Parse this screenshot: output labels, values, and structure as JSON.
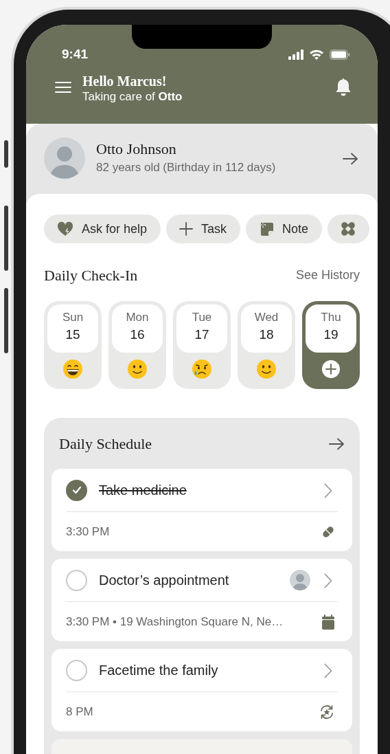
{
  "status_bar": {
    "time": "9:41"
  },
  "header": {
    "greeting": "Hello Marcus!",
    "subtitle": "Taking care of **Otto**"
  },
  "profile": {
    "name": "Otto Johnson",
    "details": "82 years old (Birthday in 112 days)"
  },
  "quick_actions": [
    {
      "kind": "help",
      "label": "Ask for help"
    },
    {
      "kind": "task",
      "label": "Task"
    },
    {
      "kind": "note",
      "label": "Note"
    },
    {
      "kind": "bandage"
    }
  ],
  "check_in": {
    "title": "Daily Check-In",
    "link": "See History",
    "days": [
      {
        "day": "Sun",
        "date": "15",
        "kind": "grinning",
        "selected": false
      },
      {
        "day": "Mon",
        "date": "16",
        "kind": "smiling",
        "selected": false
      },
      {
        "day": "Tue",
        "date": "17",
        "kind": "sad",
        "selected": false
      },
      {
        "day": "Wed",
        "date": "18",
        "kind": "smiling",
        "selected": false
      },
      {
        "day": "Thu",
        "date": "19",
        "kind": "add",
        "selected": true
      }
    ]
  },
  "schedule": {
    "title": "Daily Schedule",
    "tasks": [
      {
        "title": "Take medicine",
        "done": true,
        "assignee": false,
        "meta": "3:30 PM",
        "kind": "medication"
      },
      {
        "title": "Doctor’s appointment",
        "done": false,
        "assignee": true,
        "meta": "3:30 PM • 19 Washington Square N, Ne…",
        "kind": "appointment"
      },
      {
        "title": "Facetime the family",
        "done": false,
        "assignee": false,
        "meta": "8 PM",
        "kind": "recurring"
      }
    ]
  }
}
